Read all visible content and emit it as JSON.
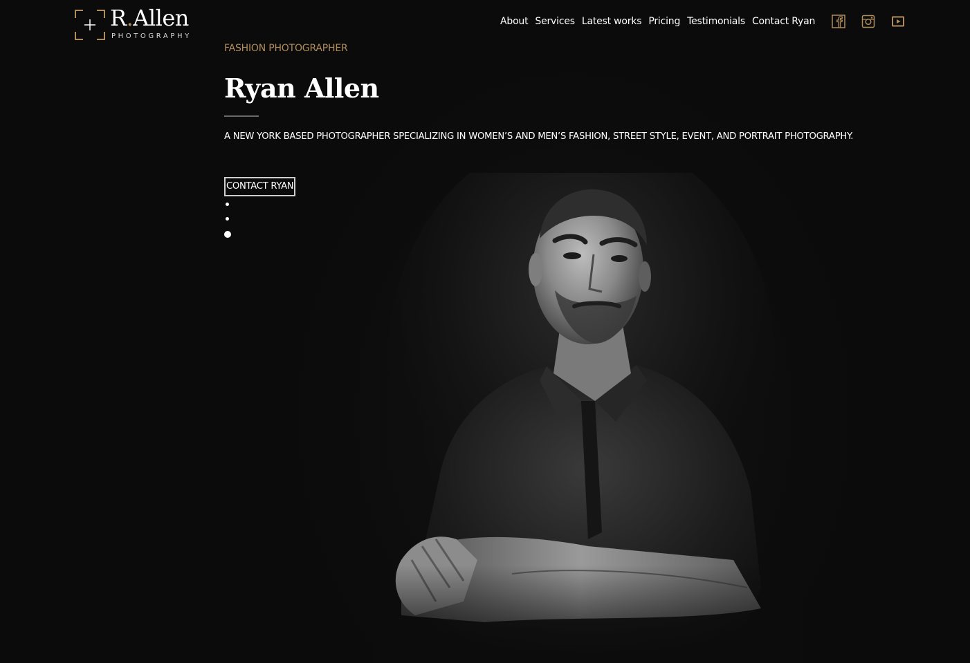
{
  "brand": {
    "title_main": "R",
    "title_dot": ".",
    "title_rest": "Allen",
    "subtitle": "PHOTOGRAPHY",
    "accent_color": "#b08d5c"
  },
  "nav": {
    "items": [
      {
        "label": "About"
      },
      {
        "label": "Services"
      },
      {
        "label": "Latest works"
      },
      {
        "label": "Pricing"
      },
      {
        "label": "Testimonials"
      },
      {
        "label": "Contact Ryan"
      }
    ]
  },
  "social": [
    {
      "icon": "facebook-icon"
    },
    {
      "icon": "instagram-icon"
    },
    {
      "icon": "youtube-icon"
    }
  ],
  "hero": {
    "eyebrow": "FASHION PHOTOGRAPHER",
    "title": "Ryan Allen",
    "tagline": "A NEW YORK BASED PHOTOGRAPHER SPECIALIZING IN WOMEN’S AND MEN’S FASHION, STREET STYLE, EVENT, AND PORTRAIT PHOTOGRAPHY.",
    "cta_label": "CONTACT RYAN",
    "slides_count": 3,
    "active_slide": 3
  },
  "colors": {
    "background": "#0c0c0c",
    "text": "#ffffff",
    "accent": "#b08d5c"
  }
}
